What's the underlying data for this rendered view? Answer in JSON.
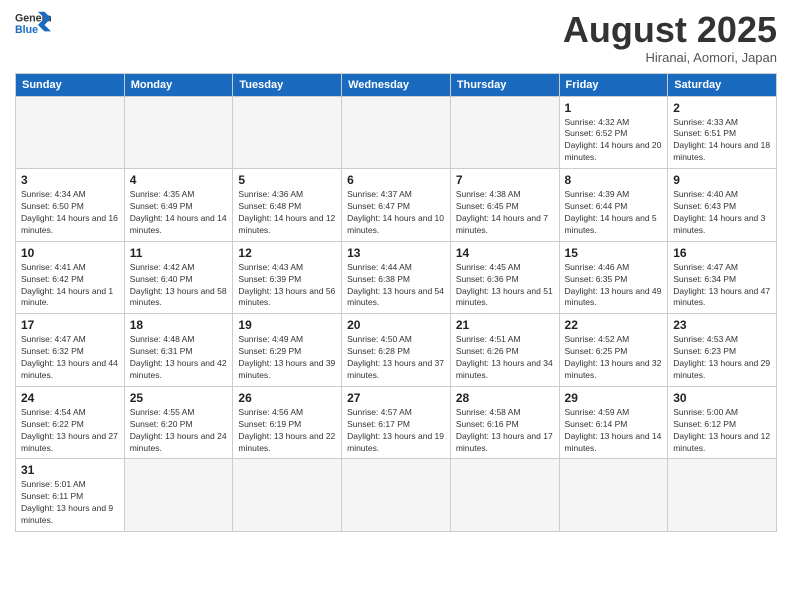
{
  "header": {
    "logo_general": "General",
    "logo_blue": "Blue",
    "month_title": "August 2025",
    "location": "Hiranai, Aomori, Japan"
  },
  "weekdays": [
    "Sunday",
    "Monday",
    "Tuesday",
    "Wednesday",
    "Thursday",
    "Friday",
    "Saturday"
  ],
  "days": {
    "d1": {
      "num": "1",
      "sunrise": "4:32 AM",
      "sunset": "6:52 PM",
      "daylight": "14 hours and 20 minutes."
    },
    "d2": {
      "num": "2",
      "sunrise": "4:33 AM",
      "sunset": "6:51 PM",
      "daylight": "14 hours and 18 minutes."
    },
    "d3": {
      "num": "3",
      "sunrise": "4:34 AM",
      "sunset": "6:50 PM",
      "daylight": "14 hours and 16 minutes."
    },
    "d4": {
      "num": "4",
      "sunrise": "4:35 AM",
      "sunset": "6:49 PM",
      "daylight": "14 hours and 14 minutes."
    },
    "d5": {
      "num": "5",
      "sunrise": "4:36 AM",
      "sunset": "6:48 PM",
      "daylight": "14 hours and 12 minutes."
    },
    "d6": {
      "num": "6",
      "sunrise": "4:37 AM",
      "sunset": "6:47 PM",
      "daylight": "14 hours and 10 minutes."
    },
    "d7": {
      "num": "7",
      "sunrise": "4:38 AM",
      "sunset": "6:45 PM",
      "daylight": "14 hours and 7 minutes."
    },
    "d8": {
      "num": "8",
      "sunrise": "4:39 AM",
      "sunset": "6:44 PM",
      "daylight": "14 hours and 5 minutes."
    },
    "d9": {
      "num": "9",
      "sunrise": "4:40 AM",
      "sunset": "6:43 PM",
      "daylight": "14 hours and 3 minutes."
    },
    "d10": {
      "num": "10",
      "sunrise": "4:41 AM",
      "sunset": "6:42 PM",
      "daylight": "14 hours and 1 minute."
    },
    "d11": {
      "num": "11",
      "sunrise": "4:42 AM",
      "sunset": "6:40 PM",
      "daylight": "13 hours and 58 minutes."
    },
    "d12": {
      "num": "12",
      "sunrise": "4:43 AM",
      "sunset": "6:39 PM",
      "daylight": "13 hours and 56 minutes."
    },
    "d13": {
      "num": "13",
      "sunrise": "4:44 AM",
      "sunset": "6:38 PM",
      "daylight": "13 hours and 54 minutes."
    },
    "d14": {
      "num": "14",
      "sunrise": "4:45 AM",
      "sunset": "6:36 PM",
      "daylight": "13 hours and 51 minutes."
    },
    "d15": {
      "num": "15",
      "sunrise": "4:46 AM",
      "sunset": "6:35 PM",
      "daylight": "13 hours and 49 minutes."
    },
    "d16": {
      "num": "16",
      "sunrise": "4:47 AM",
      "sunset": "6:34 PM",
      "daylight": "13 hours and 47 minutes."
    },
    "d17": {
      "num": "17",
      "sunrise": "4:47 AM",
      "sunset": "6:32 PM",
      "daylight": "13 hours and 44 minutes."
    },
    "d18": {
      "num": "18",
      "sunrise": "4:48 AM",
      "sunset": "6:31 PM",
      "daylight": "13 hours and 42 minutes."
    },
    "d19": {
      "num": "19",
      "sunrise": "4:49 AM",
      "sunset": "6:29 PM",
      "daylight": "13 hours and 39 minutes."
    },
    "d20": {
      "num": "20",
      "sunrise": "4:50 AM",
      "sunset": "6:28 PM",
      "daylight": "13 hours and 37 minutes."
    },
    "d21": {
      "num": "21",
      "sunrise": "4:51 AM",
      "sunset": "6:26 PM",
      "daylight": "13 hours and 34 minutes."
    },
    "d22": {
      "num": "22",
      "sunrise": "4:52 AM",
      "sunset": "6:25 PM",
      "daylight": "13 hours and 32 minutes."
    },
    "d23": {
      "num": "23",
      "sunrise": "4:53 AM",
      "sunset": "6:23 PM",
      "daylight": "13 hours and 29 minutes."
    },
    "d24": {
      "num": "24",
      "sunrise": "4:54 AM",
      "sunset": "6:22 PM",
      "daylight": "13 hours and 27 minutes."
    },
    "d25": {
      "num": "25",
      "sunrise": "4:55 AM",
      "sunset": "6:20 PM",
      "daylight": "13 hours and 24 minutes."
    },
    "d26": {
      "num": "26",
      "sunrise": "4:56 AM",
      "sunset": "6:19 PM",
      "daylight": "13 hours and 22 minutes."
    },
    "d27": {
      "num": "27",
      "sunrise": "4:57 AM",
      "sunset": "6:17 PM",
      "daylight": "13 hours and 19 minutes."
    },
    "d28": {
      "num": "28",
      "sunrise": "4:58 AM",
      "sunset": "6:16 PM",
      "daylight": "13 hours and 17 minutes."
    },
    "d29": {
      "num": "29",
      "sunrise": "4:59 AM",
      "sunset": "6:14 PM",
      "daylight": "13 hours and 14 minutes."
    },
    "d30": {
      "num": "30",
      "sunrise": "5:00 AM",
      "sunset": "6:12 PM",
      "daylight": "13 hours and 12 minutes."
    },
    "d31": {
      "num": "31",
      "sunrise": "5:01 AM",
      "sunset": "6:11 PM",
      "daylight": "13 hours and 9 minutes."
    }
  },
  "labels": {
    "sunrise": "Sunrise:",
    "sunset": "Sunset:",
    "daylight": "Daylight:"
  }
}
